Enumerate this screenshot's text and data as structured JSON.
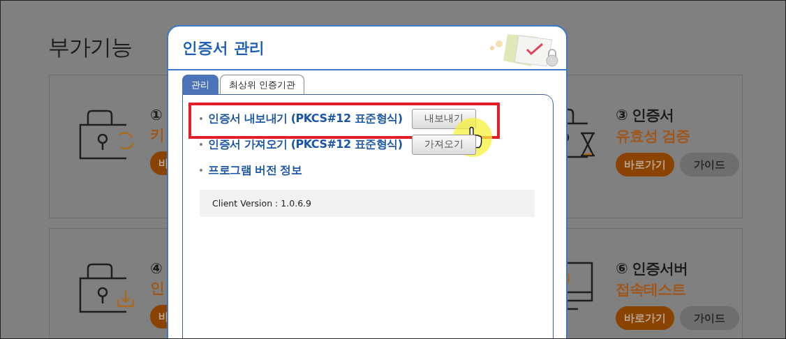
{
  "page": {
    "title": "부가기능",
    "cards": [
      {
        "kind": "lock-refresh",
        "heading": "①",
        "subtitle": "키",
        "buttons": [
          {
            "label": "바",
            "kind": "primary"
          }
        ]
      },
      {
        "kind": "lock-hourglass",
        "heading": "③ 인증서",
        "subtitle": "유효성 검증",
        "buttons": [
          {
            "label": "바로가기",
            "kind": "primary"
          },
          {
            "label": "가이드",
            "kind": "secondary"
          }
        ]
      },
      {
        "kind": "lock-download",
        "heading": "④",
        "subtitle": "인",
        "buttons": [
          {
            "label": "바",
            "kind": "primary"
          }
        ]
      },
      {
        "kind": "monitor-check",
        "heading": "⑥ 인증서버",
        "subtitle": "접속테스트",
        "buttons": [
          {
            "label": "바로가기",
            "kind": "primary"
          },
          {
            "label": "가이드",
            "kind": "secondary"
          }
        ]
      }
    ]
  },
  "dialog": {
    "title": "인증서 관리",
    "tabs": [
      {
        "label": "관리",
        "selected": true
      },
      {
        "label": "최상위 인증기관",
        "selected": false
      }
    ],
    "items": [
      {
        "label": "인증서 내보내기 (PKCS#12 표준형식)",
        "button": "내보내기",
        "highlighted": true
      },
      {
        "label": "인증서 가져오기 (PKCS#12 표준형식)",
        "button": "가져오기",
        "highlighted": false
      },
      {
        "label": "프로그램 버전 정보",
        "info": "Client Version : 1.0.6.9",
        "highlighted": false
      }
    ]
  }
}
